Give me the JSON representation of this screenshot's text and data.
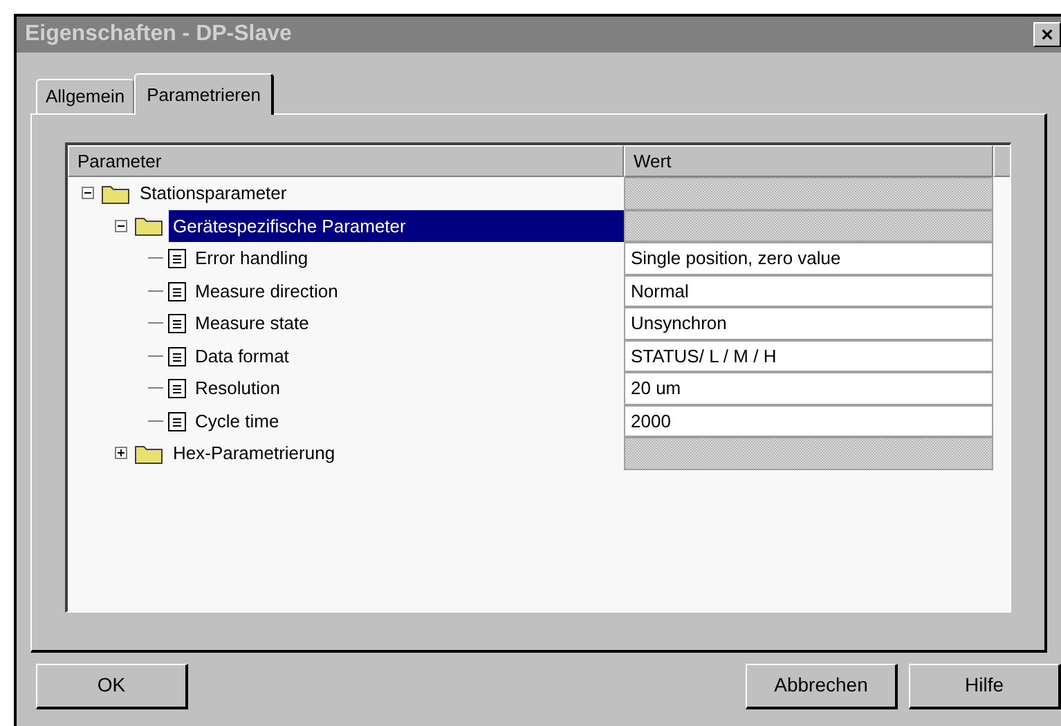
{
  "window": {
    "title": "Eigenschaften - DP-Slave",
    "close": "×"
  },
  "tabs": [
    {
      "label": "Allgemein",
      "selected": false
    },
    {
      "label": "Parametrieren",
      "selected": true
    }
  ],
  "table": {
    "columns": [
      "Parameter",
      "Wert"
    ],
    "rows": [
      {
        "kind": "folder",
        "label": "Stationsparameter",
        "expanded": true,
        "selected": false,
        "children": [
          {
            "kind": "folder",
            "label": "Gerätespezifische Parameter",
            "expanded": true,
            "selected": true,
            "children": [
              {
                "kind": "param",
                "label": "Error handling",
                "value": "Single position, zero value",
                "selected": false
              },
              {
                "kind": "param",
                "label": "Measure direction",
                "value": "Normal",
                "selected": false
              },
              {
                "kind": "param",
                "label": "Measure state",
                "value": "Unsynchron",
                "selected": false
              },
              {
                "kind": "param",
                "label": "Data format",
                "value": "STATUS/ L / M / H",
                "selected": false
              },
              {
                "kind": "param",
                "label": "Resolution",
                "value": "20 um",
                "selected": false
              },
              {
                "kind": "param",
                "label": "Cycle time",
                "value": "2000",
                "selected": false
              }
            ]
          },
          {
            "kind": "folder",
            "label": "Hex-Parametrierung",
            "expanded": false,
            "selected": false
          }
        ]
      }
    ]
  },
  "buttons": [
    "OK",
    "Abbrechen",
    "Hilfe"
  ]
}
